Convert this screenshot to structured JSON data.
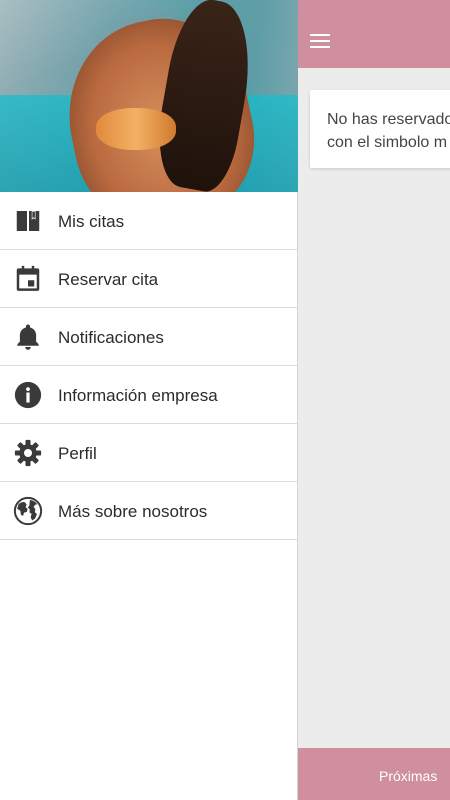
{
  "topbar": {
    "background": "#cf8f9e",
    "menu_icon": "hamburger-icon"
  },
  "main": {
    "card_line1": "No has reservado",
    "card_line2": "con el simbolo m"
  },
  "bottombar": {
    "tab_label": "Próximas"
  },
  "drawer": {
    "header_image": "beach-woman-photo",
    "items": [
      {
        "label": "Mis citas",
        "icon": "book-icon"
      },
      {
        "label": "Reservar cita",
        "icon": "calendar-icon"
      },
      {
        "label": "Notificaciones",
        "icon": "bell-icon"
      },
      {
        "label": "Información empresa",
        "icon": "info-icon"
      },
      {
        "label": "Perfil",
        "icon": "gear-icon"
      },
      {
        "label": "Más sobre nosotros",
        "icon": "globe-icon"
      }
    ]
  },
  "colors": {
    "accent": "#cf8f9e",
    "icon": "#3a3a3a",
    "background": "#ececec"
  }
}
